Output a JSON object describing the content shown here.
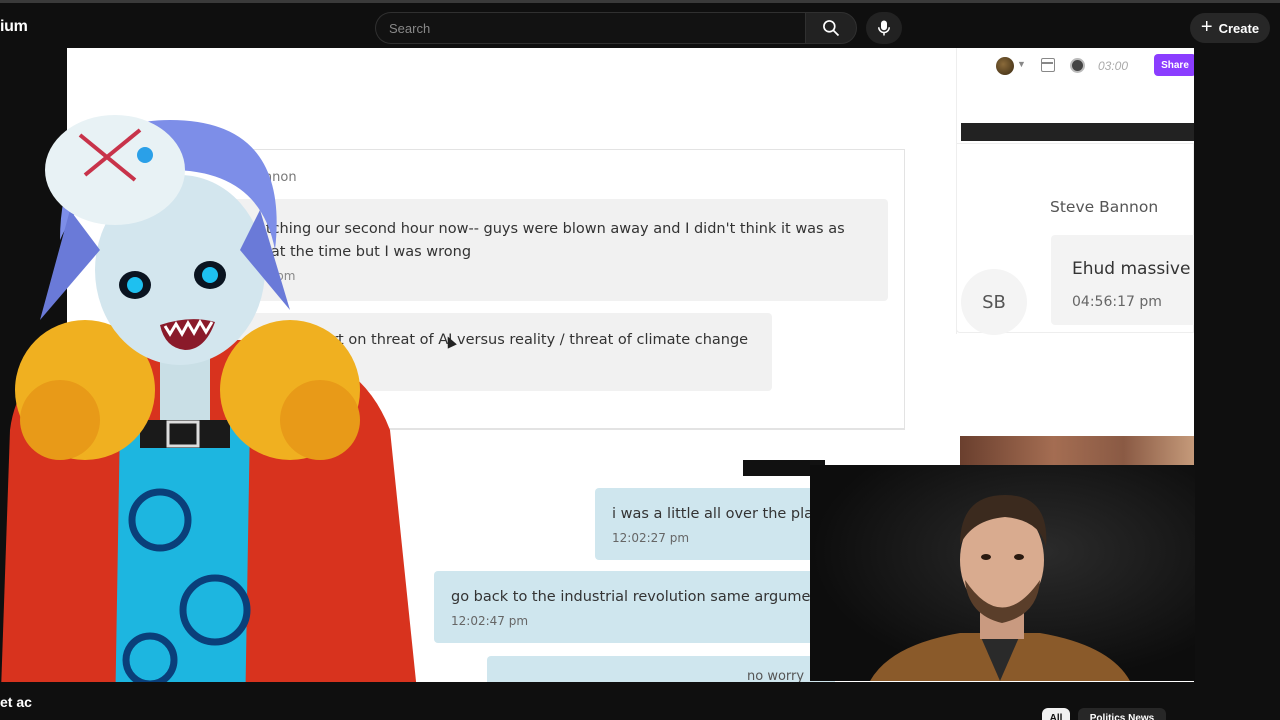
{
  "app": {
    "brand_fragment": "ium"
  },
  "search": {
    "placeholder": "Search"
  },
  "header": {
    "create_label": "Create"
  },
  "chat": {
    "sender_fragment": "Bannon",
    "messages_left": [
      {
        "text": "atching our second hour now-- guys were blown away and I didn't think it was as",
        "text2": "g at the time but I was wrong",
        "time": "47 pm"
      },
      {
        "text": "part on threat of AI versus reality / threat of climate change"
      }
    ],
    "messages_right": [
      {
        "text": "i was a little all over the place",
        "time": "12:02:27 pm"
      },
      {
        "text": "go back to the industrial revolution   same argument.",
        "time": "12:02:47 pm"
      },
      {
        "text": "no worry"
      }
    ]
  },
  "side_panel": {
    "timer": "03:00",
    "share_label": "Share",
    "contact_name": "Steve Bannon",
    "initials": "SB",
    "message_preview": "Ehud massive",
    "message_time": "04:56:17 pm"
  },
  "bottom_bar": {
    "left_fragment": "et ac",
    "chips": [
      "All",
      "Politics News"
    ]
  },
  "colors": {
    "share_button": "#8b3dff",
    "sent_bubble": "#cfe6ee",
    "received_bubble": "#f1f1f1",
    "app_background": "#0f0f0f"
  },
  "icons": [
    "search-icon",
    "mic-icon",
    "plus-icon",
    "layout-icon",
    "record-icon"
  ]
}
